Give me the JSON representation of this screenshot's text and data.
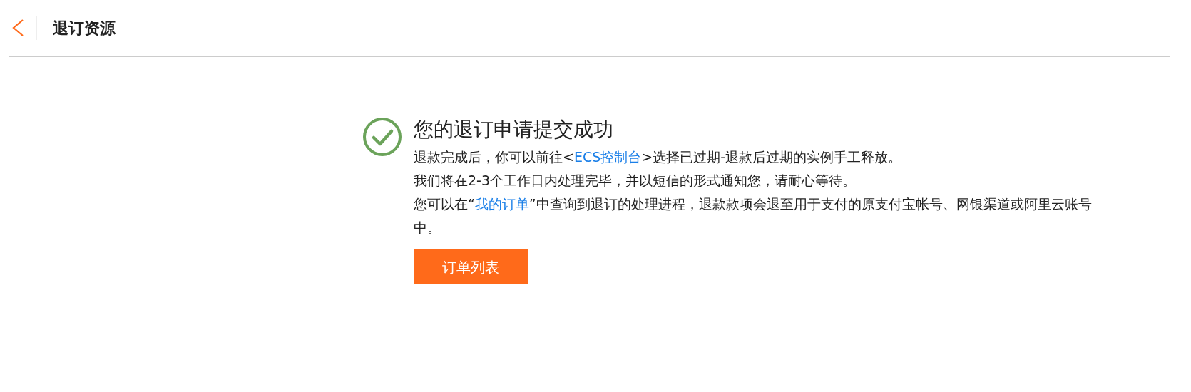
{
  "header": {
    "title": "退订资源"
  },
  "result": {
    "title": "您的退订申请提交成功",
    "lines": [
      {
        "segments": [
          {
            "kind": "text",
            "text": "退款完成后，你可以前往<"
          },
          {
            "kind": "link",
            "text": "ECS控制台"
          },
          {
            "kind": "text",
            "text": ">选择已过期-退款后过期的实例手工释放。"
          }
        ]
      },
      {
        "segments": [
          {
            "kind": "text",
            "text": "我们将在2-3个工作日内处理完毕，并以短信的形式通知您，请耐心等待。"
          }
        ]
      },
      {
        "segments": [
          {
            "kind": "text",
            "text": "您可以在“"
          },
          {
            "kind": "link",
            "text": "我的订单"
          },
          {
            "kind": "text",
            "text": "”中查询到退订的处理进程，退款款项会退至用于支付的原支付宝帐号、网银渠道或阿里云账号中。"
          }
        ]
      }
    ],
    "button": "订单列表"
  }
}
